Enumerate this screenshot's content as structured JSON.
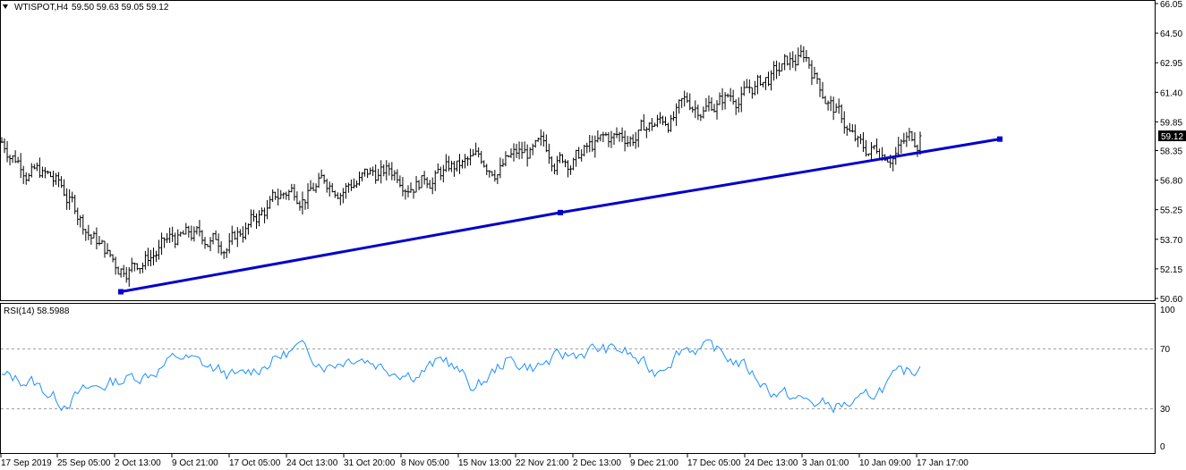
{
  "header": {
    "symbol": "WTISPOT,H4",
    "ohlc": "59.50 59.63 59.05 59.12"
  },
  "rsi": {
    "label": "RSI(14) 58.5988",
    "levels": [
      70,
      30
    ],
    "scale_labels": [
      "100",
      "70",
      "30",
      "0"
    ]
  },
  "chart_data": [
    {
      "type": "ohlc-bar",
      "title": "WTISPOT,H4",
      "ylim": [
        50.6,
        66.05
      ],
      "y_ticks": [
        "66.05",
        "64.50",
        "62.95",
        "61.40",
        "59.85",
        "58.35",
        "56.80",
        "55.25",
        "53.70",
        "52.15",
        "50.60"
      ],
      "current_price": "59.12",
      "x_ticks": [
        "17 Sep 2019",
        "25 Sep 05:00",
        "2 Oct 13:00",
        "9 Oct 21:00",
        "17 Oct 05:00",
        "24 Oct 13:00",
        "31 Oct 20:00",
        "8 Nov 05:00",
        "15 Nov 13:00",
        "22 Nov 21:00",
        "2 Dec 13:00",
        "9 Dec 21:00",
        "17 Dec 05:00",
        "24 Dec 13:00",
        "3 Jan 01:00",
        "10 Jan 09:00",
        "17 Jan 17:00"
      ],
      "series_close_approx": [
        [
          "17 Sep 2019",
          58.8
        ],
        [
          "25 Sep 05:00",
          56.4
        ],
        [
          "2 Oct 13:00",
          52.3
        ],
        [
          "9 Oct 21:00",
          53.6
        ],
        [
          "17 Oct 05:00",
          53.7
        ],
        [
          "24 Oct 13:00",
          56.2
        ],
        [
          "31 Oct 20:00",
          56.9
        ],
        [
          "8 Nov 05:00",
          57.2
        ],
        [
          "15 Nov 13:00",
          57.4
        ],
        [
          "22 Nov 21:00",
          58.0
        ],
        [
          "2 Dec 13:00",
          58.1
        ],
        [
          "9 Dec 21:00",
          59.2
        ],
        [
          "17 Dec 05:00",
          60.6
        ],
        [
          "24 Dec 13:00",
          61.5
        ],
        [
          "3 Jan 01:00",
          63.2
        ],
        [
          "10 Jan 09:00",
          58.1
        ],
        [
          "17 Jan 17:00",
          59.12
        ]
      ],
      "trendline": [
        [
          "2 Oct 13:00",
          50.95
        ],
        [
          "2 Dec 13:00",
          55.1
        ],
        [
          "21 Jan",
          58.95
        ]
      ]
    },
    {
      "type": "line",
      "title": "RSI(14) 58.5988",
      "ylim": [
        0,
        100
      ],
      "levels": [
        70,
        30
      ],
      "series_approx": [
        51,
        48,
        33,
        42,
        49,
        54,
        66,
        58,
        50,
        62,
        72,
        60,
        67,
        58,
        53,
        64,
        42,
        63,
        58,
        66,
        71,
        70,
        54,
        73,
        71,
        60,
        41,
        34,
        30,
        32,
        48,
        58
      ]
    }
  ],
  "colors": {
    "bars": "#000000",
    "trendline": "#0000CD",
    "rsi": "#1E90FF",
    "price_tag_bg": "#000000"
  }
}
